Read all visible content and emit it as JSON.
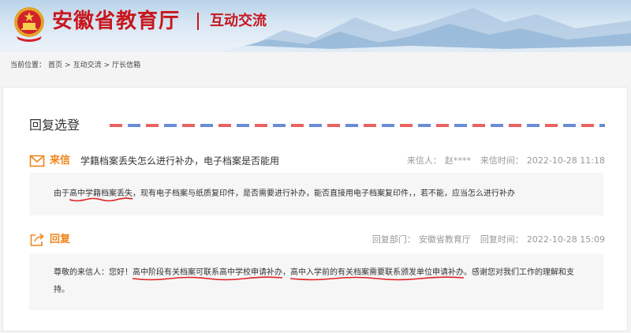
{
  "header": {
    "site_title": "安徽省教育厅",
    "section_title": "互动交流"
  },
  "breadcrumb": {
    "prefix": "当前位置：",
    "items": [
      "首页",
      ">",
      "互动交流",
      ">",
      "厅长信箱"
    ]
  },
  "card": {
    "title": "回复选登"
  },
  "letter": {
    "label": "来信",
    "subject": "学籍档案丢失怎么进行补办，电子档案是否能用",
    "sender_label": "来信人：",
    "sender": "赵****",
    "time_label": "来信时间：",
    "time": "2022-10-28 11:18",
    "body_pre": "由于",
    "body_highlight": "高中学籍档案丢失",
    "body_post": "，现有电子档案与纸质复印件，是否需要进行补办，能否直接用电子档案复印件，，若不能，应当怎么进行补办"
  },
  "reply": {
    "label": "回复",
    "dept_label": "回复部门：",
    "dept": "安徽省教育厅",
    "time_label": "回复时间：",
    "time": "2022-10-28 15:09",
    "body_pre": "尊敬的来信人：您好！",
    "body_highlight1": "高中阶段有关档案可联系高中学校申请补办",
    "body_mid": "，",
    "body_highlight2": "高中入学前的有关档案需要联系颁发单位申请补办",
    "body_post": "。感谢您对我们工作的理解和支持。"
  },
  "colors": {
    "brand_red": "#c8161d",
    "accent_orange": "#f08519",
    "underline_red": "#e02020"
  }
}
